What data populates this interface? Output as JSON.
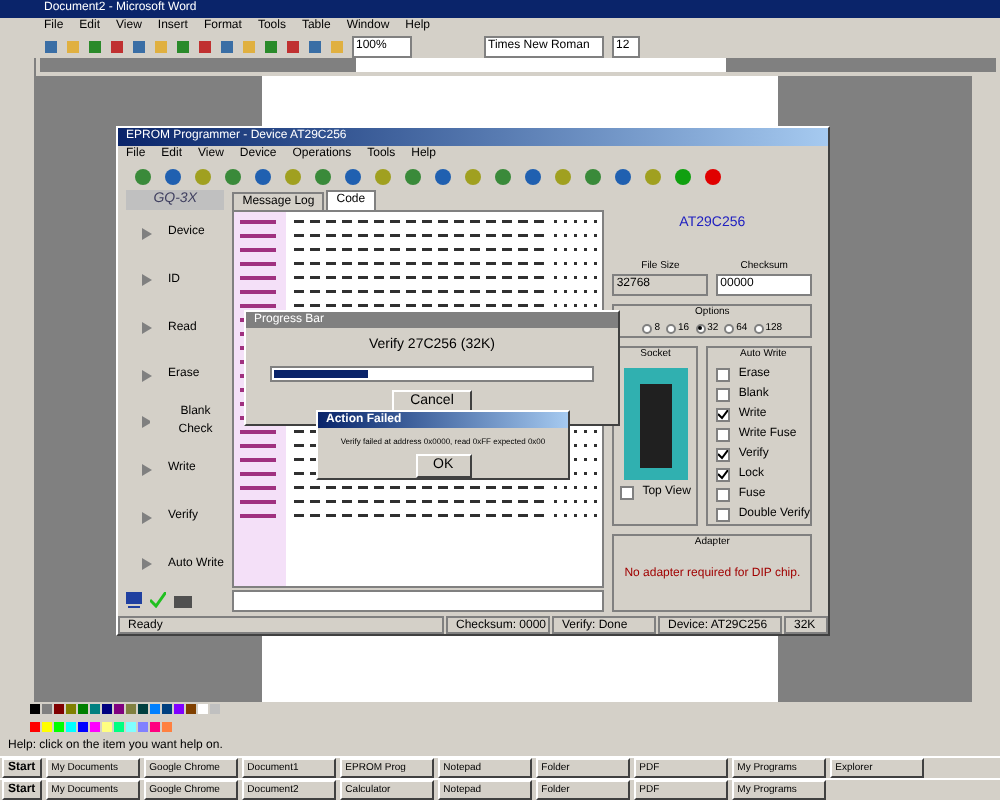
{
  "word": {
    "title": "Document2 - Microsoft Word",
    "menu": [
      "File",
      "Edit",
      "View",
      "Insert",
      "Format",
      "Tools",
      "Table",
      "Window",
      "Help"
    ],
    "zoom": "100%",
    "font": "Times New Roman",
    "size": "12",
    "status": "Help: click on the item you want help on."
  },
  "palette": [
    {
      "color": "#000000"
    },
    {
      "color": "#808080"
    },
    {
      "color": "#800000"
    },
    {
      "color": "#808000"
    },
    {
      "color": "#008000"
    },
    {
      "color": "#008080"
    },
    {
      "color": "#000080"
    },
    {
      "color": "#800080"
    },
    {
      "color": "#808040"
    },
    {
      "color": "#004040"
    },
    {
      "color": "#0080ff"
    },
    {
      "color": "#004080"
    },
    {
      "color": "#8000ff"
    },
    {
      "color": "#804000"
    },
    {
      "color": "#ffffff"
    },
    {
      "color": "#c0c0c0"
    },
    {
      "color": "#ff0000"
    },
    {
      "color": "#ffff00"
    },
    {
      "color": "#00ff00"
    },
    {
      "color": "#00ffff"
    },
    {
      "color": "#0000ff"
    },
    {
      "color": "#ff00ff"
    },
    {
      "color": "#ffff80"
    },
    {
      "color": "#00ff80"
    },
    {
      "color": "#80ffff"
    },
    {
      "color": "#8080ff"
    },
    {
      "color": "#ff0080"
    },
    {
      "color": "#ff8040"
    }
  ],
  "programmer": {
    "title": "EPROM Programmer - Device AT29C256",
    "menu": [
      "File",
      "Edit",
      "View",
      "Device",
      "Operations",
      "Tools",
      "Help"
    ],
    "brand": "GQ-3X",
    "tabs": [
      {
        "label": "Message Log",
        "selected": false
      },
      {
        "label": "Code",
        "selected": true
      }
    ],
    "actions": [
      "Device",
      "ID",
      "Read",
      "Erase",
      "Blank Check",
      "Write",
      "Verify",
      "Auto Write"
    ],
    "chip": "AT29C256",
    "file_size_label": "File Size",
    "file_size": "32768",
    "checksum_label": "Checksum",
    "checksum": "00000",
    "options_label": "Options",
    "options": [
      {
        "label": "8",
        "selected": false
      },
      {
        "label": "16",
        "selected": false
      },
      {
        "label": "32",
        "selected": true
      },
      {
        "label": "64",
        "selected": false
      },
      {
        "label": "128",
        "selected": false
      }
    ],
    "socket_label": "Socket",
    "top_view": {
      "label": "Top View",
      "checked": false
    },
    "auto_label": "Auto Write",
    "steps": [
      {
        "label": "Erase",
        "checked": false
      },
      {
        "label": "Blank",
        "checked": false
      },
      {
        "label": "Write",
        "checked": true
      },
      {
        "label": "Write Fuse",
        "checked": false
      },
      {
        "label": "Verify",
        "checked": true
      },
      {
        "label": "Lock",
        "checked": true
      },
      {
        "label": "Fuse",
        "checked": false
      }
    ],
    "double_verify": {
      "label": "Double Verify",
      "checked": false
    },
    "adapter_label": "Adapter",
    "adapter_note": "No adapter required for DIP chip.",
    "status": [
      "Ready",
      "Checksum: 0000",
      "Verify: Done",
      "Device: AT29C256",
      "32K"
    ]
  },
  "progress": {
    "title": "Progress Bar",
    "text": "Verify 27C256 (32K)",
    "level": 0.3,
    "button": "Cancel"
  },
  "alert": {
    "title": "Action Failed",
    "message": "Verify failed at address 0x0000, read 0xFF expected 0x00",
    "button": "OK"
  },
  "taskbars": [
    [
      "Start",
      "My Documents",
      "Google Chrome",
      "Document1",
      "EPROM Prog",
      "Notepad",
      "Folder",
      "PDF",
      "My Programs",
      "Explorer"
    ],
    [
      "Start",
      "My Documents",
      "Google Chrome",
      "Document2",
      "Calculator",
      "Notepad",
      "Folder",
      "PDF",
      "My Programs"
    ]
  ]
}
